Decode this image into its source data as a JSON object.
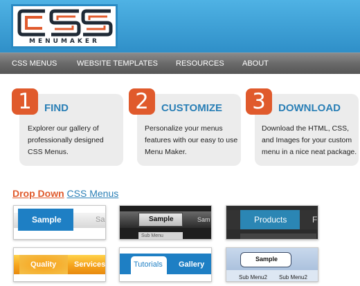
{
  "logo": {
    "letters": "CSS",
    "subtitle": "MENUMAKER",
    "colors": {
      "orange": "#e05a2c",
      "dark": "#1f2a36",
      "blue": "#2a8ac3"
    }
  },
  "nav": {
    "items": [
      {
        "label": "CSS MENUS"
      },
      {
        "label": "WEBSITE TEMPLATES"
      },
      {
        "label": "RESOURCES"
      },
      {
        "label": "ABOUT"
      }
    ]
  },
  "steps": [
    {
      "number": "1",
      "title": "FIND",
      "description": "Explorer our gallery of professionally designed CSS Menus."
    },
    {
      "number": "2",
      "title": "CUSTOMIZE",
      "description": "Personalize your menus features with our easy to use Menu Maker."
    },
    {
      "number": "3",
      "title": "DOWNLOAD",
      "description": "Download the HTML, CSS, and Images for your custom menu in a nice neat package."
    }
  ],
  "section": {
    "accent": "Drop Down",
    "rest": "CSS Menus"
  },
  "thumbnails": [
    {
      "labels": [
        "Sample",
        "Sa"
      ]
    },
    {
      "labels": [
        "Sample",
        "Sam",
        "Sub Menu"
      ]
    },
    {
      "labels": [
        "Products",
        "F"
      ]
    },
    {
      "labels": [
        "Quality",
        "Services"
      ]
    },
    {
      "labels": [
        "Tutorials",
        "Gallery"
      ]
    },
    {
      "labels": [
        "Sample",
        "Sub Menu2",
        "Sub Menu2"
      ]
    }
  ]
}
